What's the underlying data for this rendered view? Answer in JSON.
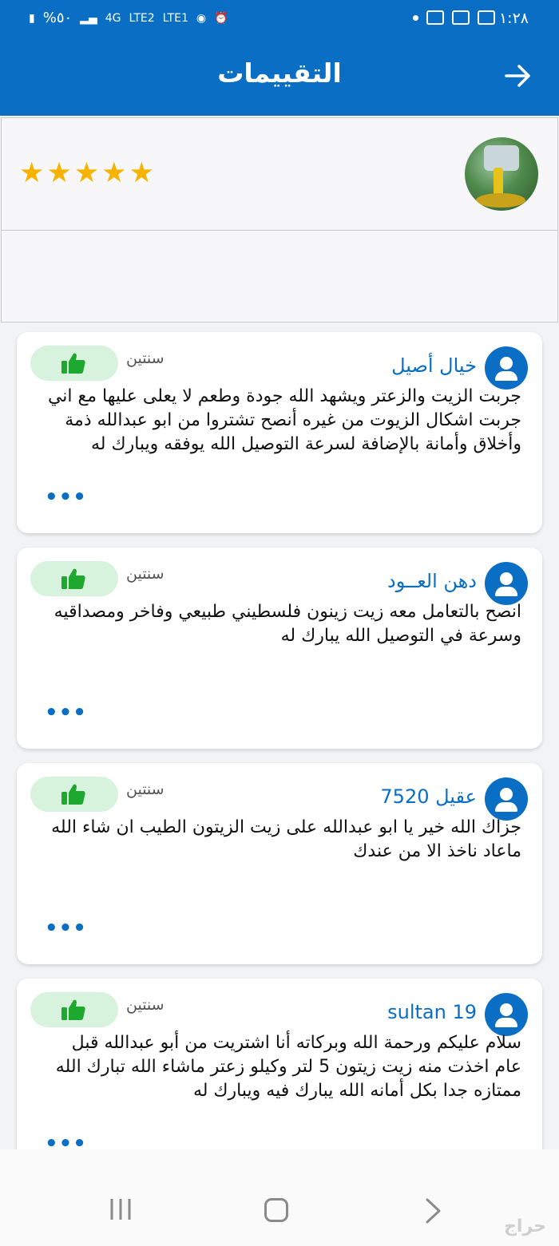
{
  "status_bar": {
    "time": "١:٢٨",
    "battery": "%٥٠",
    "network_1": "4G",
    "network_2": "LTE2",
    "network_3": "LTE1"
  },
  "header": {
    "title": "التقييمات"
  },
  "summary": {
    "rating": 5,
    "max_rating": 5,
    "stars": "★★★★★"
  },
  "reviews": [
    {
      "name": "خيال أصيل",
      "time": "سنتين",
      "text": "جربت الزيت والزعتر ويشهد الله جودة وطعم لا يعلى عليها مع اني جربت اشكال الزيوت من غيره   أنصح تشتروا من ابو عبدالله   ذمة وأخلاق وأمانة بالإضافة لسرعة التوصيل الله يوفقه ويبارك له",
      "more": "•••"
    },
    {
      "name": "دهن العــود",
      "time": "سنتين",
      "text": "انصح بالتعامل معه  زيت زينون فلسطيني طبيعي وفاخر ومصداقيه وسرعة في التوصيل  الله يبارك له",
      "more": "•••"
    },
    {
      "name": "عقيل 7520",
      "time": "سنتين",
      "text": "جزاك الله خير يا ابو عبدالله على زيت الزيتون الطيب  ان شاء الله ماعاد ناخذ الا من عندك",
      "more": "•••"
    },
    {
      "name": "sultan 19",
      "time": "سنتين",
      "text": "سلام عليكم ورحمة الله وبركاته أنا اشتريت من أبو عبدالله قبل عام اخذت منه زيت زيتون 5 لتر وكيلو زعتر ماشاء الله تبارك الله ممتازه جدا بكل أمانه الله يبارك فيه ويبارك له",
      "more": "•••"
    }
  ],
  "watermark": "حراج",
  "colors": {
    "primary": "#0a6ec4",
    "star": "#f6b400",
    "like_bg": "#d8f3dd",
    "like_icon": "#1fa82f"
  }
}
